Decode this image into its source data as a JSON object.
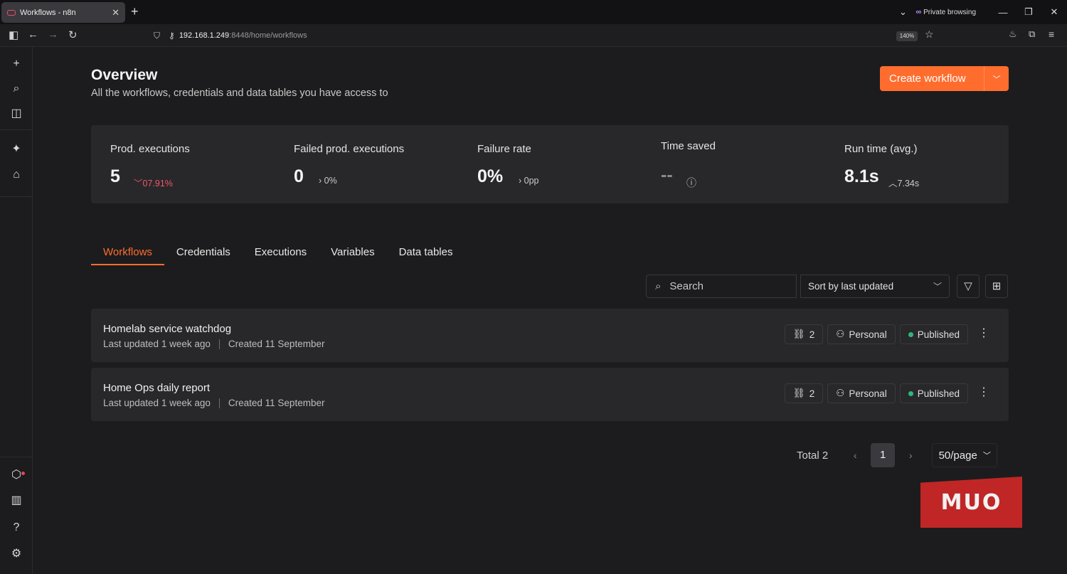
{
  "browser": {
    "tab_title": "Workflows - n8n",
    "tab_close": "✕",
    "new_tab": "+",
    "private_label": "Private browsing",
    "url_host": "192.168.1.249",
    "url_path": ":8448/home/workflows",
    "zoom": "140%"
  },
  "header": {
    "title": "Overview",
    "subtitle": "All the workflows, credentials and data tables you have access to",
    "create_label": "Create workflow"
  },
  "stats": [
    {
      "label": "Prod. executions",
      "value": "5",
      "trend": "07.91%",
      "trend_dir": "down"
    },
    {
      "label": "Failed prod. executions",
      "value": "0",
      "trend": "0%",
      "trend_dir": "neutral"
    },
    {
      "label": "Failure rate",
      "value": "0%",
      "trend": "0pp",
      "trend_dir": "neutral"
    },
    {
      "label": "Time saved",
      "value": "--",
      "trend": "",
      "trend_dir": "info"
    },
    {
      "label": "Run time (avg.)",
      "value": "8.1s",
      "trend": "7.34s",
      "trend_dir": "up"
    }
  ],
  "tabs": [
    "Workflows",
    "Credentials",
    "Executions",
    "Variables",
    "Data tables"
  ],
  "toolbar": {
    "search_placeholder": "Search",
    "sort_label": "Sort by last updated"
  },
  "workflows": [
    {
      "name": "Homelab service watchdog",
      "updated": "Last updated 1 week ago",
      "created": "Created 11 September",
      "links": "2",
      "owner": "Personal",
      "status": "Published"
    },
    {
      "name": "Home Ops daily report",
      "updated": "Last updated 1 week ago",
      "created": "Created 11 September",
      "links": "2",
      "owner": "Personal",
      "status": "Published"
    }
  ],
  "pagination": {
    "total": "Total 2",
    "current": "1",
    "per_page": "50/page"
  },
  "watermark": "MUO",
  "colors": {
    "accent": "#ff6d2e",
    "published": "#2fb67c",
    "trend_down": "#f0566a"
  }
}
